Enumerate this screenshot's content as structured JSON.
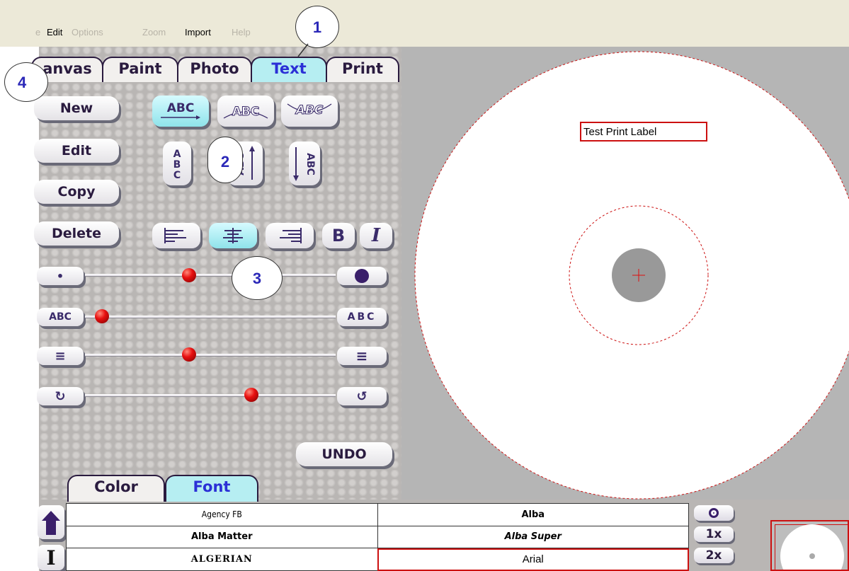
{
  "menu": {
    "items": [
      {
        "label": "e",
        "enabled": false
      },
      {
        "label": "Edit",
        "enabled": true
      },
      {
        "label": "Options",
        "enabled": false
      },
      {
        "label": "Zoom",
        "enabled": false
      },
      {
        "label": "Import",
        "enabled": true
      },
      {
        "label": "Help",
        "enabled": false
      }
    ]
  },
  "tabs": {
    "canvas": "anvas",
    "paint": "Paint",
    "photo": "Photo",
    "text": "Text",
    "print": "Print",
    "active": "Text"
  },
  "actions": {
    "new": "New",
    "edit": "Edit",
    "copy": "Copy",
    "delete": "Delete",
    "undo": "UNDO"
  },
  "text_modes": {
    "straight": "ABC",
    "arc_up": "ABC",
    "arc_down": "ABC",
    "vertical": "ABC",
    "rotate_down": "ABC"
  },
  "format": {
    "bold": "B",
    "italic": "I",
    "alignment": "center"
  },
  "sliders": {
    "size": {
      "min_label": "•",
      "max_label": "●",
      "value": 0.42
    },
    "spacing": {
      "min_label": "ABC",
      "max_label": "ABC",
      "value": 0.06
    },
    "line_spacing": {
      "min_label": "≡",
      "max_label": "≡",
      "value": 0.42
    },
    "rotation": {
      "min_label": "↻",
      "max_label": "↺",
      "value": 0.68
    }
  },
  "bottom_tabs": {
    "color": "Color",
    "font": "Font",
    "active": "Font"
  },
  "fonts": [
    {
      "name": "Agency FB",
      "selected": false
    },
    {
      "name": "Alba",
      "selected": false
    },
    {
      "name": "Alba Matter",
      "selected": false
    },
    {
      "name": "Alba Super",
      "selected": false
    },
    {
      "name": "ALGERIAN",
      "selected": false
    },
    {
      "name": "Arial",
      "selected": true
    }
  ],
  "zoom_buttons": {
    "zoom_1x": "1x",
    "zoom_2x": "2x"
  },
  "canvas": {
    "label_text": "Test Print Label"
  },
  "callouts": [
    "1",
    "2",
    "3",
    "4"
  ],
  "colors": {
    "accent": "#2b2fd6",
    "tab_active": "#b6eef2",
    "knob": "#e81010",
    "dashed_outline": "#cc1010",
    "selection": "#cc1010"
  }
}
